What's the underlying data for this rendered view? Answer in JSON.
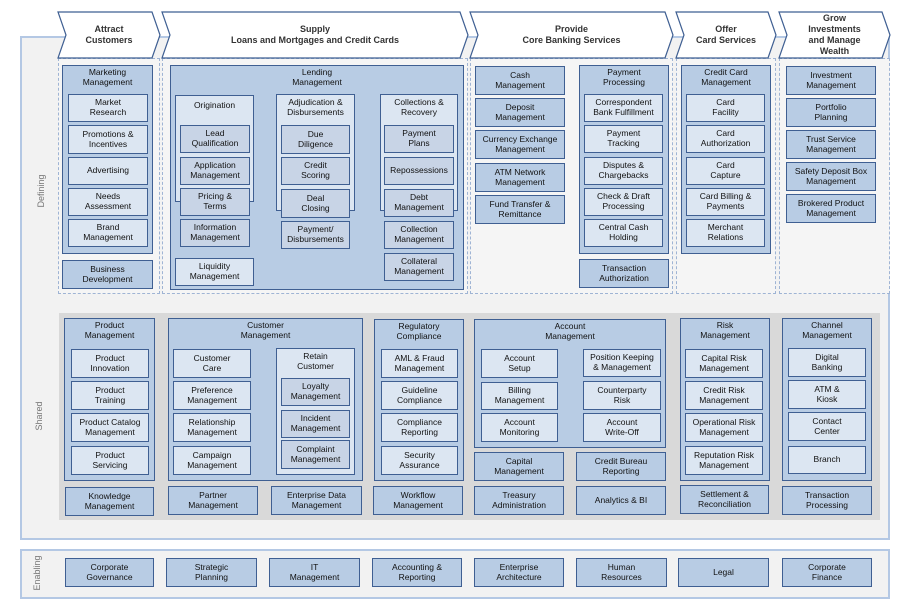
{
  "labels": {
    "defining": "Defining",
    "shared": "Shared",
    "enabling": "Enabling"
  },
  "headers": [
    "Attract\nCustomers",
    "Supply\nLoans and Mortgages and Credit Cards",
    "Provide\nCore Banking Services",
    "Offer\nCard Services",
    "Grow\nInvestments\nand Manage\nWealth"
  ],
  "colors": {
    "group_fill": "#b8cce4",
    "light_fill": "#dce6f2",
    "border": "#3f5f92",
    "shared_bg": "#d9d9d9"
  },
  "defining": {
    "attract": {
      "marketing": {
        "title": "Marketing\nManagement",
        "items": [
          "Market\nResearch",
          "Promotions &\nIncentives",
          "Advertising",
          "Needs\nAssessment",
          "Brand\nManagement"
        ]
      },
      "business_development": "Business\nDevelopment"
    },
    "supply": {
      "lending": {
        "title": "Lending\nManagement",
        "origination": {
          "title": "Origination",
          "items": [
            "Lead\nQualification",
            "Application\nManagement",
            "Pricing &\nTerms",
            "Information\nManagement"
          ]
        },
        "adjudication": {
          "title": "Adjudication &\nDisbursements",
          "items": [
            "Due\nDiligence",
            "Credit\nScoring",
            "Deal\nClosing",
            "Payment/\nDisbursements"
          ]
        },
        "collections": {
          "title": "Collections &\nRecovery",
          "items": [
            "Payment\nPlans",
            "Repossessions",
            "Debt\nManagement",
            "Collection\nManagement",
            "Collateral\nManagement"
          ]
        },
        "liquidity": "Liquidity\nManagement"
      }
    },
    "provide": {
      "left": [
        "Cash\nManagement",
        "Deposit\nManagement",
        "Currency Exchange\nManagement",
        "ATM Network\nManagement",
        "Fund Transfer &\nRemittance"
      ],
      "payment": {
        "title": "Payment\nProcessing",
        "items": [
          "Correspondent\nBank Fulfillment",
          "Payment\nTracking",
          "Disputes &\nChargebacks",
          "Check & Draft\nProcessing",
          "Central Cash\nHolding"
        ]
      },
      "transaction_authorization": "Transaction\nAuthorization"
    },
    "offer": {
      "credit_card": {
        "title": "Credit Card\nManagement",
        "items": [
          "Card\nFacility",
          "Card\nAuthorization",
          "Card\nCapture",
          "Card Billing &\nPayments",
          "Merchant\nRelations"
        ]
      }
    },
    "grow": {
      "items": [
        "Investment\nManagement",
        "Portfolio\nPlanning",
        "Trust Service\nManagement",
        "Safety Deposit Box\nManagement",
        "Brokered Product\nManagement"
      ]
    }
  },
  "shared": {
    "product": {
      "title": "Product\nManagement",
      "items": [
        "Product\nInnovation",
        "Product\nTraining",
        "Product Catalog\nManagement",
        "Product\nServicing"
      ]
    },
    "knowledge": "Knowledge\nManagement",
    "customer": {
      "title": "Customer\nManagement",
      "items": [
        "Customer\nCare",
        "Preference\nManagement",
        "Relationship\nManagement",
        "Campaign\nManagement"
      ],
      "retain": {
        "title": "Retain\nCustomer",
        "items": [
          "Loyalty\nManagement",
          "Incident\nManagement",
          "Complaint\nManagement"
        ]
      }
    },
    "partner": "Partner\nManagement",
    "enterprise_data": "Enterprise Data\nManagement",
    "regulatory": {
      "title": "Regulatory\nCompliance",
      "items": [
        "AML & Fraud\nManagement",
        "Guideline\nCompliance",
        "Compliance\nReporting",
        "Security\nAssurance"
      ]
    },
    "workflow": "Workflow\nManagement",
    "account": {
      "title": "Account\nManagement",
      "left": [
        "Account\nSetup",
        "Billing\nManagement",
        "Account\nMonitoring"
      ],
      "right": [
        "Position Keeping\n& Management",
        "Counterparty\nRisk",
        "Account\nWrite-Off"
      ]
    },
    "capital": "Capital\nManagement",
    "credit_bureau": "Credit Bureau\nReporting",
    "treasury": "Treasury\nAdministration",
    "analytics": "Analytics & BI",
    "risk": {
      "title": "Risk\nManagement",
      "items": [
        "Capital Risk\nManagement",
        "Credit Risk\nManagement",
        "Operational Risk\nManagement",
        "Reputation Risk\nManagement"
      ]
    },
    "settlement": "Settlement &\nReconciliation",
    "channel": {
      "title": "Channel\nManagement",
      "items": [
        "Digital\nBanking",
        "ATM &\nKiosk",
        "Contact\nCenter",
        "Branch"
      ]
    },
    "transaction_processing": "Transaction\nProcessing"
  },
  "enabling": {
    "items": [
      "Corporate\nGovernance",
      "Strategic\nPlanning",
      "IT\nManagement",
      "Accounting &\nReporting",
      "Enterprise\nArchitecture",
      "Human\nResources",
      "Legal",
      "Corporate\nFinance"
    ]
  }
}
